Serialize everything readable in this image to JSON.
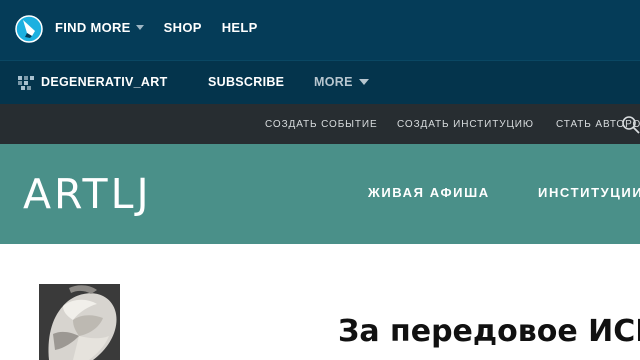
{
  "topbar": {
    "logo_icon": "livejournal-logo-icon",
    "nav": [
      {
        "label": "FIND MORE",
        "has_caret": true
      },
      {
        "label": "SHOP",
        "has_caret": false
      },
      {
        "label": "HELP",
        "has_caret": false
      }
    ]
  },
  "journalbar": {
    "journal_icon": "journal-grid-icon",
    "journal_name": "DEGENERATIV_ART",
    "subscribe_label": "SUBSCRIBE",
    "more_label": "MORE"
  },
  "actionbar": {
    "actions": [
      "СОЗДАТЬ СОБЫТИЕ",
      "СОЗДАТЬ ИНСТИТУЦИЮ",
      "СТАТЬ АВТОРОМ"
    ],
    "search_icon": "search-icon"
  },
  "sitebar": {
    "brand": "ARTLJ",
    "menu": [
      "ЖИВАЯ АФИША",
      "ИНСТИТУЦИИ"
    ]
  },
  "post": {
    "title": "За передовое ИСКУССТВО",
    "avatar_icon": "sculpture-avatar-image"
  },
  "colors": {
    "topbar_bg": "#053c58",
    "journalbar_bg": "#04344c",
    "actionbar_bg": "#272d31",
    "sitebar_bg": "#4a9089",
    "logo_accent": "#1cb0e0"
  }
}
